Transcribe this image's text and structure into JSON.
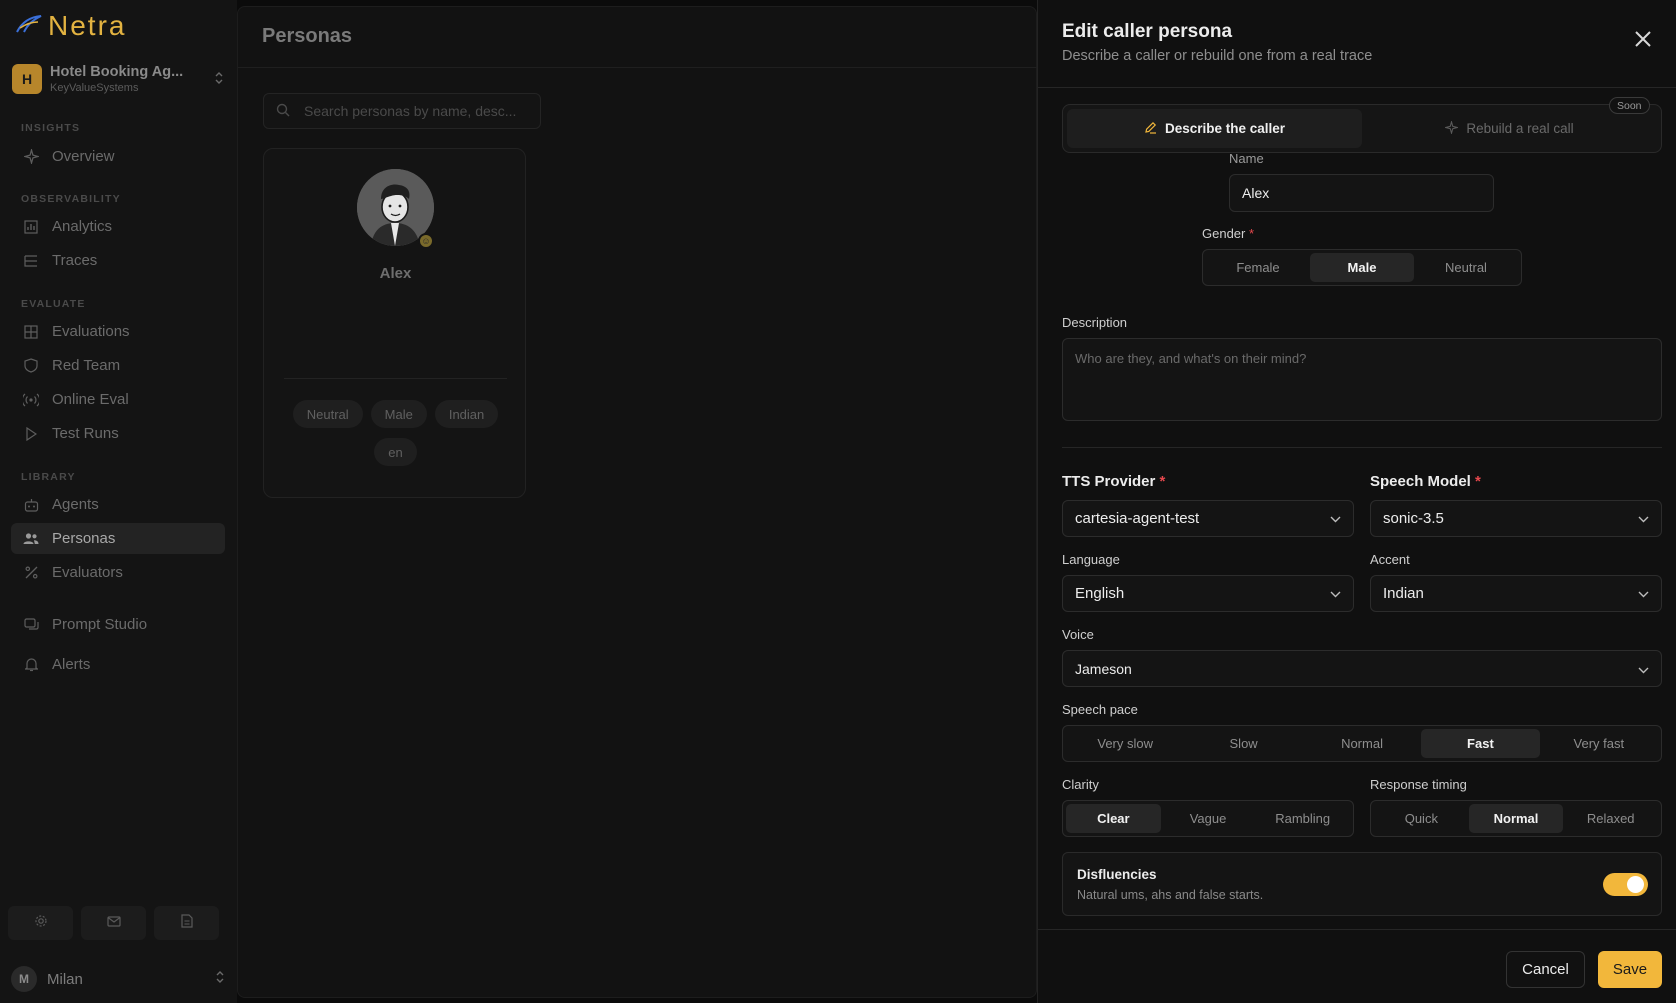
{
  "app": {
    "name": "Netra"
  },
  "org": {
    "initial": "H",
    "name": "Hotel Booking Ag...",
    "sub": "KeyValueSystems"
  },
  "nav": {
    "sections": [
      "INSIGHTS",
      "OBSERVABILITY",
      "EVALUATE",
      "LIBRARY"
    ],
    "items": [
      {
        "label": "Overview",
        "icon": "sparkle-icon"
      },
      {
        "label": "Analytics",
        "icon": "bar-chart-icon"
      },
      {
        "label": "Traces",
        "icon": "list-tree-icon"
      },
      {
        "label": "Evaluations",
        "icon": "grid-icon"
      },
      {
        "label": "Red Team",
        "icon": "shield-icon"
      },
      {
        "label": "Online Eval",
        "icon": "broadcast-icon"
      },
      {
        "label": "Test Runs",
        "icon": "play-icon"
      },
      {
        "label": "Agents",
        "icon": "bot-icon"
      },
      {
        "label": "Personas",
        "icon": "users-icon",
        "active": true
      },
      {
        "label": "Evaluators",
        "icon": "percent-icon"
      },
      {
        "label": "Prompt Studio",
        "icon": "chat-icon"
      },
      {
        "label": "Alerts",
        "icon": "bell-icon"
      }
    ]
  },
  "user": {
    "initial": "M",
    "name": "Milan"
  },
  "main": {
    "title": "Personas",
    "search_placeholder": "Search personas by name, desc...",
    "card": {
      "name": "Alex",
      "tags": [
        "Neutral",
        "Male",
        "Indian",
        "en"
      ]
    }
  },
  "panel": {
    "title": "Edit caller persona",
    "subtitle": "Describe a caller or rebuild one from a real trace",
    "tabs": {
      "describe": "Describe the caller",
      "rebuild": "Rebuild a real call",
      "soon": "Soon"
    },
    "name": {
      "label": "Name",
      "value": "Alex"
    },
    "gender": {
      "label": "Gender",
      "options": [
        "Female",
        "Male",
        "Neutral"
      ],
      "selected": "Male"
    },
    "description": {
      "label": "Description",
      "placeholder": "Who are they, and what's on their mind?"
    },
    "tts_provider": {
      "label": "TTS Provider",
      "value": "cartesia-agent-test"
    },
    "speech_model": {
      "label": "Speech Model",
      "value": "sonic-3.5"
    },
    "language": {
      "label": "Language",
      "value": "English"
    },
    "accent": {
      "label": "Accent",
      "value": "Indian"
    },
    "voice": {
      "label": "Voice",
      "value": "Jameson"
    },
    "speech_pace": {
      "label": "Speech pace",
      "options": [
        "Very slow",
        "Slow",
        "Normal",
        "Fast",
        "Very fast"
      ],
      "selected": "Fast"
    },
    "clarity": {
      "label": "Clarity",
      "options": [
        "Clear",
        "Vague",
        "Rambling"
      ],
      "selected": "Clear"
    },
    "response_timing": {
      "label": "Response timing",
      "options": [
        "Quick",
        "Normal",
        "Relaxed"
      ],
      "selected": "Normal"
    },
    "disfluencies": {
      "title": "Disfluencies",
      "subtitle": "Natural ums, ahs and false starts.",
      "enabled": true
    },
    "cancel": "Cancel",
    "save": "Save"
  },
  "colors": {
    "accent": "#f2b73b",
    "required": "#e5484d"
  }
}
